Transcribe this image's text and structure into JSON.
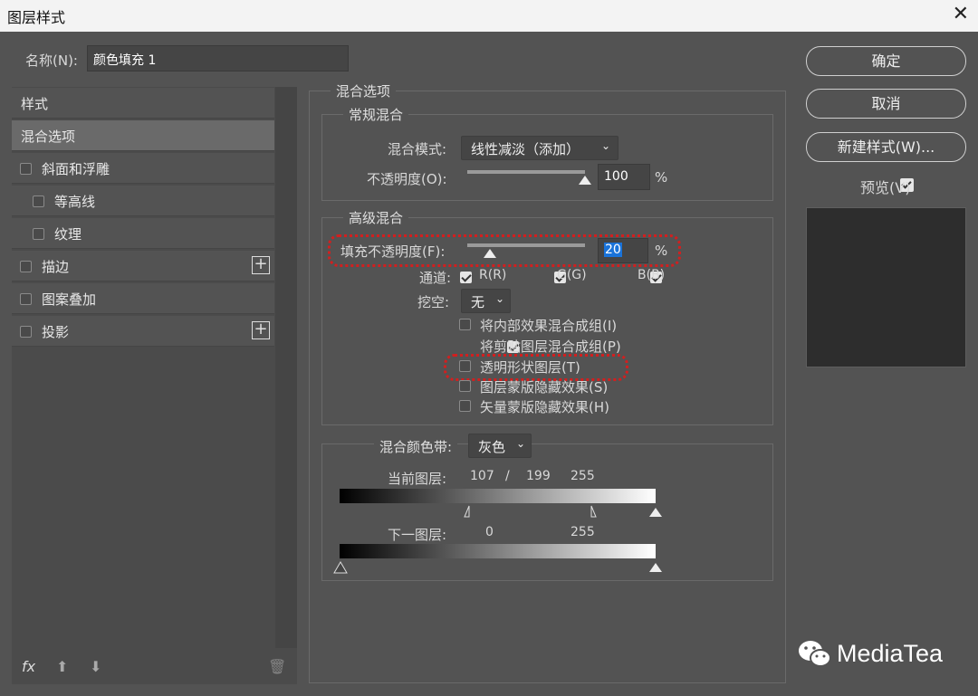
{
  "window": {
    "title": "图层样式",
    "close_glyph": "✕"
  },
  "name_field": {
    "label": "名称(N):",
    "value": "颜色填充 1"
  },
  "sidebar": {
    "header": "样式",
    "items": [
      {
        "label": "混合选项",
        "checkbox": false,
        "active": true
      },
      {
        "label": "斜面和浮雕",
        "checkbox": true,
        "checked": false
      },
      {
        "label": "等高线",
        "checkbox": true,
        "checked": false
      },
      {
        "label": "纹理",
        "checkbox": true,
        "checked": false
      },
      {
        "label": "描边",
        "checkbox": true,
        "checked": false,
        "plus": true
      },
      {
        "label": "图案叠加",
        "checkbox": true,
        "checked": false
      },
      {
        "label": "投影",
        "checkbox": true,
        "checked": false,
        "plus": true
      }
    ],
    "footer": {
      "fx": "fx",
      "up": "⬆",
      "down": "⬇",
      "trash": "🗑"
    }
  },
  "blend_options": {
    "title": "混合选项",
    "general": {
      "title": "常规混合",
      "mode_label": "混合模式:",
      "mode_value": "线性减淡（添加）",
      "opacity_label": "不透明度(O):",
      "opacity_value": "100",
      "opacity_unit": "%",
      "opacity_fraction": 1.0
    },
    "advanced": {
      "title": "高级混合",
      "fill_label": "填充不透明度(F):",
      "fill_value": "20",
      "fill_unit": "%",
      "fill_fraction": 0.2,
      "channels_label": "通道:",
      "channels": [
        {
          "label": "R(R)",
          "checked": true
        },
        {
          "label": "G(G)",
          "checked": true
        },
        {
          "label": "B(B)",
          "checked": true
        }
      ],
      "knockout_label": "挖空:",
      "knockout_value": "无",
      "options": [
        {
          "label": "将内部效果混合成组(I)",
          "checked": false
        },
        {
          "label": "将剪贴图层混合成组(P)",
          "checked": true
        },
        {
          "label": "透明形状图层(T)",
          "checked": false
        },
        {
          "label": "图层蒙版隐藏效果(S)",
          "checked": false
        },
        {
          "label": "矢量蒙版隐藏效果(H)",
          "checked": false
        }
      ]
    },
    "blend_if": {
      "label": "混合颜色带:",
      "value": "灰色",
      "current_label": "当前图层:",
      "current_low": "107",
      "current_sep": "/",
      "current_mid": "199",
      "current_high": "255",
      "next_label": "下一图层:",
      "next_low": "0",
      "next_high": "255"
    }
  },
  "buttons": {
    "ok": "确定",
    "cancel": "取消",
    "new_style": "新建样式(W)...",
    "preview_label": "预览(V)",
    "preview_checked": true
  },
  "watermark": {
    "text": "MediaTea"
  },
  "colors": {
    "background": "#535353",
    "highlight": "#d21f1f",
    "selection": "#1a73d9"
  }
}
